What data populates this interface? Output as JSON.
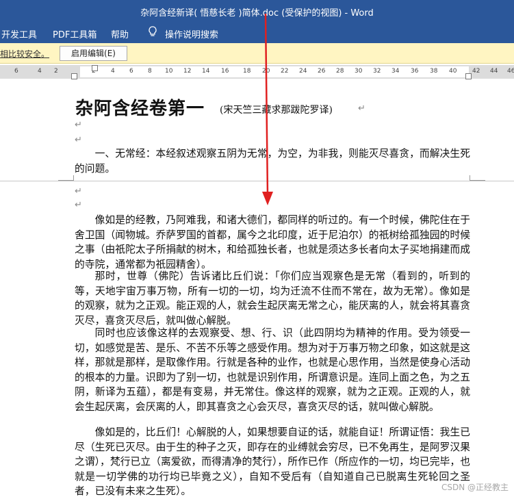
{
  "window": {
    "title": "杂阿含经新译( 悟慈长老 )简体.doc (受保护的视图)  -  Word"
  },
  "ribbon": {
    "tabs": [
      "开发工具",
      "PDF工具箱",
      "帮助",
      "操作说明搜索"
    ]
  },
  "protected_bar": {
    "message": "相比较安全。",
    "enable_button": "启用编辑(E)"
  },
  "ruler": {
    "ticks": [
      "6",
      "4",
      "2",
      "",
      "2",
      "4",
      "6",
      "8",
      "10",
      "12",
      "14",
      "16",
      "18",
      "20",
      "22",
      "24",
      "26",
      "28",
      "30",
      "32",
      "34",
      "36",
      "38",
      "40",
      "42",
      "44",
      "46"
    ]
  },
  "document": {
    "heading": "杂阿含经卷第一",
    "heading_sub": "(宋天竺三藏求那跋陀罗译)",
    "para_mark": "↵",
    "intro": "一、无常经：本经叙述观察五阴为无常，为空，为非我，则能灭尽喜贪，而解决生死的问题。",
    "paragraphs": [
      "像如是的经教，乃阿难我，和诸大德们，都同样的听过的。有一个时候，佛陀住在于舍卫国（闻物城。乔萨罗国的首都，属今之北印度，近于尼泊尔）的祇树给孤独园的时候之事（由祇陀太子所捐献的树木，和给孤独长者，也就是须达多长者向太子买地捐建而成的寺院，通常都为祇园精舍）。",
      "那时，世尊（佛陀）告诉诸比丘们说：「你们应当观察色是无常（看到的，听到的等，天地宇宙万事万物，所有一切的一切，均为迁流不住而不常在，故为无常）。像如是的观察，就为之正观。能正观的人，就会生起厌离无常之心，能厌离的人，就会将其喜贪灭尽，喜贪灭尽后，就叫做心解脱。",
      "同时也应该像这样的去观察受、想、行、识（此四阴均为精神的作用。受为领受一切，如感觉是苦、是乐、不苦不乐等之感受作用。想为对于万事万物之印象，如这就是这样，那就是那样，是取像作用。行就是各种的业作，也就是心思作用，当然是使身心活动的根本的力量。识即为了别一切，也就是识别作用，所谓意识是。连同上面之色，为之五阴，新译为五蕴），都是有变易，并无常住。像这样的观察，就为之正观。正观的人，就会生起厌离，会厌离的人，即其喜贪之心会灭尽，喜贪灭尽的话，就叫做心解脱。",
      "像如是的，比丘们！心解脱的人，如果想要自证的话，就能自证！所谓证悟：我生已尽（生死已灭尽。由于生的种子之灭，即存在的业缚就会穷尽，已不免再生，是阿罗汉果之谓），梵行已立（离爱欲，而得清净的梵行），所作已作（所应作的一切，均已完毕，也就是一切学佛的功行均已毕竟之义），自知不受后有（自知道自己已脱离生死轮回之圣者，已没有未来之生死）。"
    ]
  },
  "watermark": "CSDN @正经教主"
}
